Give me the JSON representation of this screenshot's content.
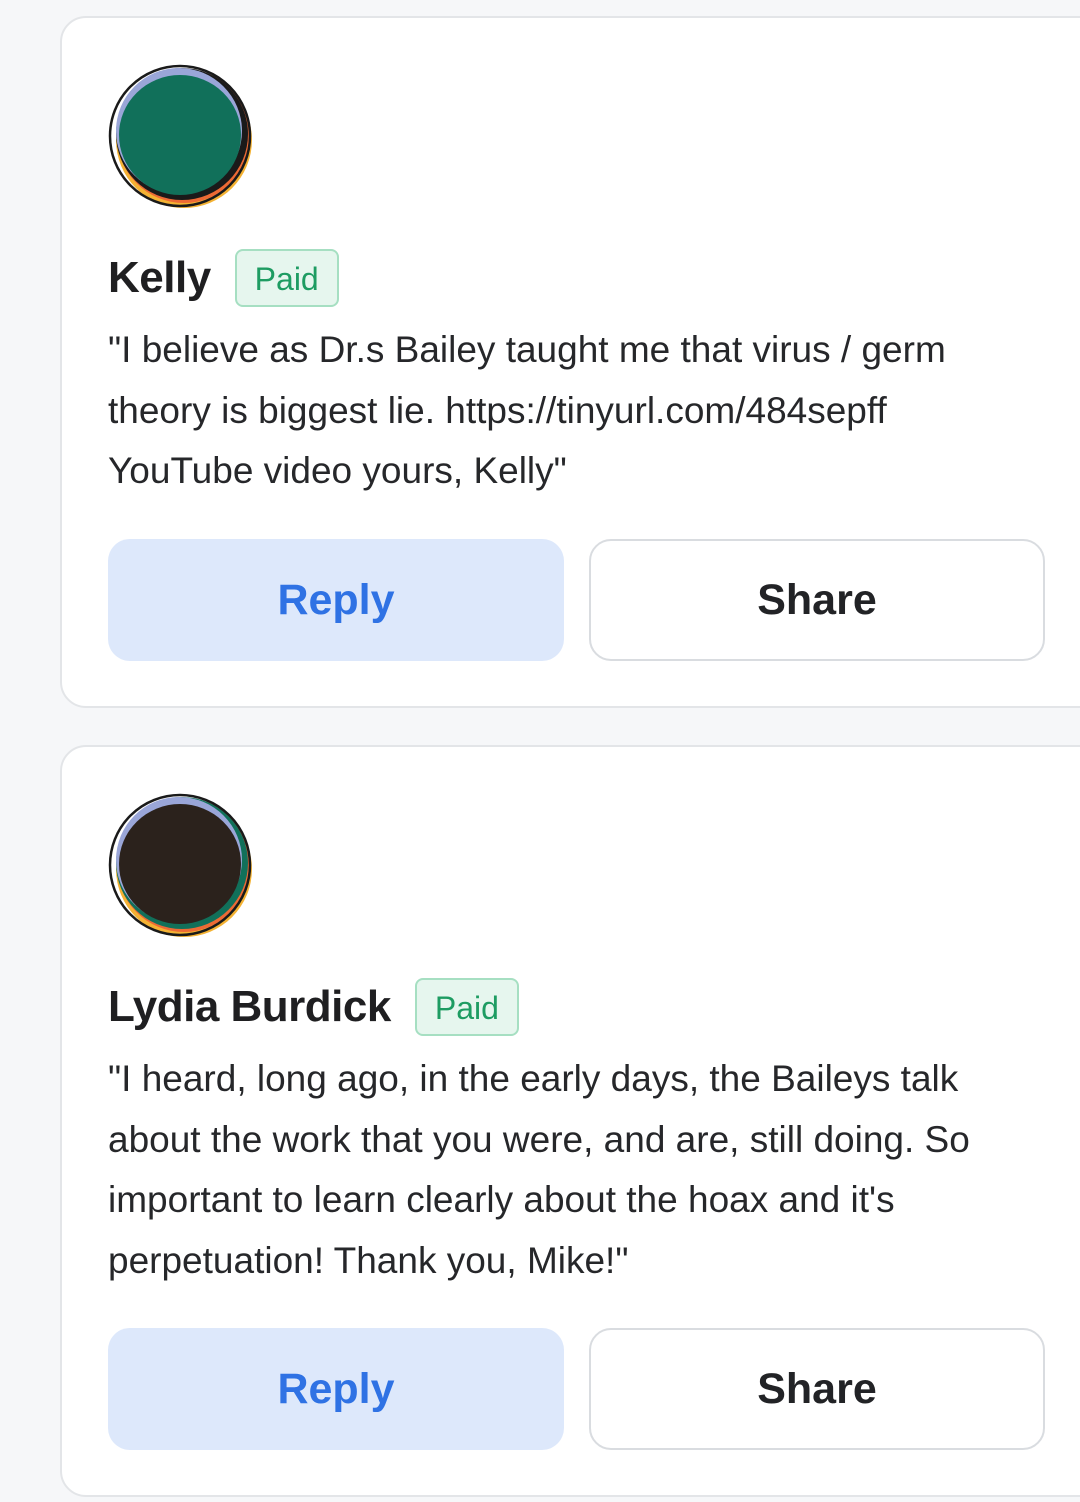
{
  "comments": [
    {
      "name": "Kelly",
      "badge": "Paid",
      "avatar_icon": "avatar-green-circle-icon",
      "avatar_color": "#11705a",
      "text": "\"I believe as Dr.s Bailey taught me that virus / germ theory is biggest lie. https://tinyurl.com/484sepff YouTube video yours, Kelly\"",
      "reply_label": "Reply",
      "share_label": "Share"
    },
    {
      "name": "Lydia Burdick",
      "badge": "Paid",
      "avatar_icon": "avatar-dark-circle-icon",
      "avatar_color": "#2b221c",
      "text": "\"I heard, long ago, in the early days, the Baileys talk about the work that you were, and are, still doing. So important to learn clearly about the hoax and it's perpetuation! Thank you, Mike!\"",
      "reply_label": "Reply",
      "share_label": "Share"
    }
  ],
  "colors": {
    "reply_bg": "#dde8fb",
    "reply_text": "#2f72e4",
    "badge_bg": "#e6f6ee",
    "badge_text": "#1e9c62"
  }
}
